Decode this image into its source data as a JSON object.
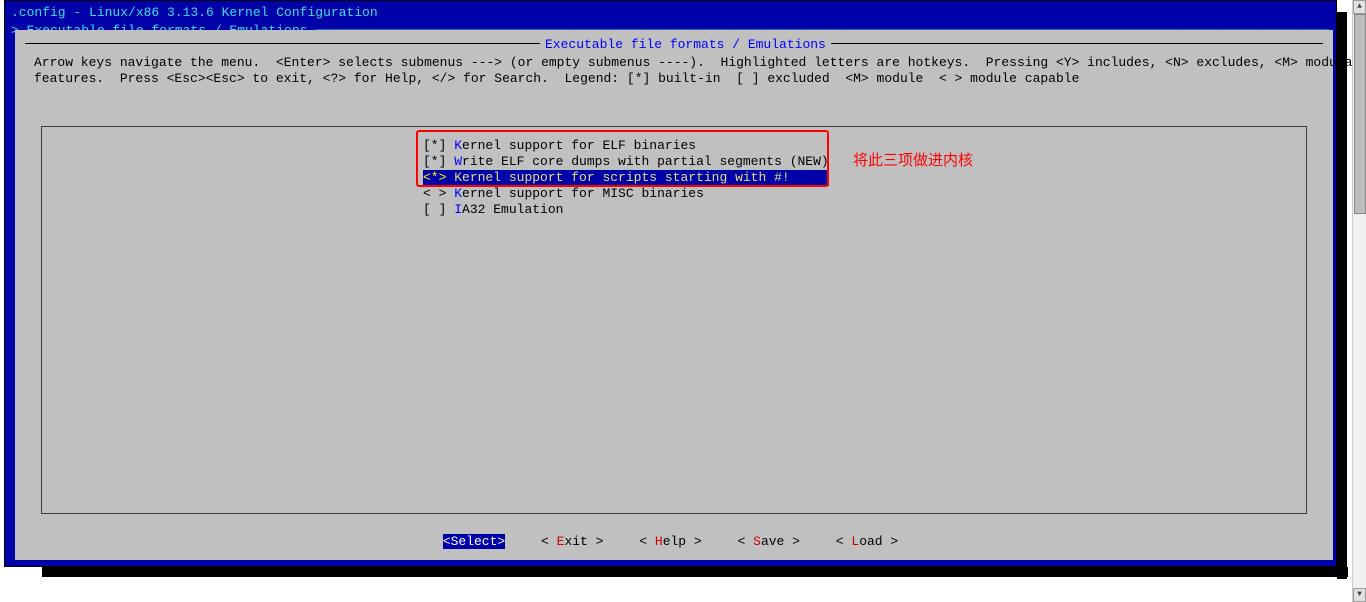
{
  "title": ".config - Linux/x86 3.13.6 Kernel Configuration",
  "breadcrumb": "> Executable file formats / Emulations ──────────────────────────────────────────────────────────────────────────────────────────────────────────────────────────────────",
  "submenu_title": "Executable file formats / Emulations",
  "help_line1": "Arrow keys navigate the menu.  <Enter> selects submenus ---> (or empty submenus ----).  Highlighted letters are hotkeys.  Pressing <Y> includes, <N> excludes, <M> modularizes",
  "help_line2": "features.  Press <Esc><Esc> to exit, <?> for Help, </> for Search.  Legend: [*] built-in  [ ] excluded  <M> module  < > module capable",
  "options": [
    {
      "mark": "[*]",
      "hot": "K",
      "rest": "ernel support for ELF binaries",
      "tail": "",
      "selected": false
    },
    {
      "mark": "[*]",
      "hot": "W",
      "rest": "rite ELF core dumps with partial segments",
      "tail": " (NEW)",
      "selected": false
    },
    {
      "mark": "<*>",
      "hot": "K",
      "rest": "ernel support for scripts starting with #!",
      "tail": "",
      "selected": true
    },
    {
      "mark": "< >",
      "hot": "K",
      "rest": "ernel support for MISC binaries",
      "tail": "",
      "selected": false
    },
    {
      "mark": "[ ]",
      "hot": "I",
      "rest": "A32 Emulation",
      "tail": "",
      "selected": false
    }
  ],
  "annotation": "将此三项做进内核",
  "buttons": {
    "select": {
      "left": "<",
      "key": "S",
      "rest": "elect>",
      "selected": true
    },
    "exit": {
      "left": "< ",
      "key": "E",
      "rest": "xit >"
    },
    "help": {
      "left": "< ",
      "key": "H",
      "rest": "elp >"
    },
    "save": {
      "left": "< ",
      "key": "S",
      "rest": "ave >"
    },
    "load": {
      "left": "< ",
      "key": "L",
      "rest": "oad >"
    }
  }
}
